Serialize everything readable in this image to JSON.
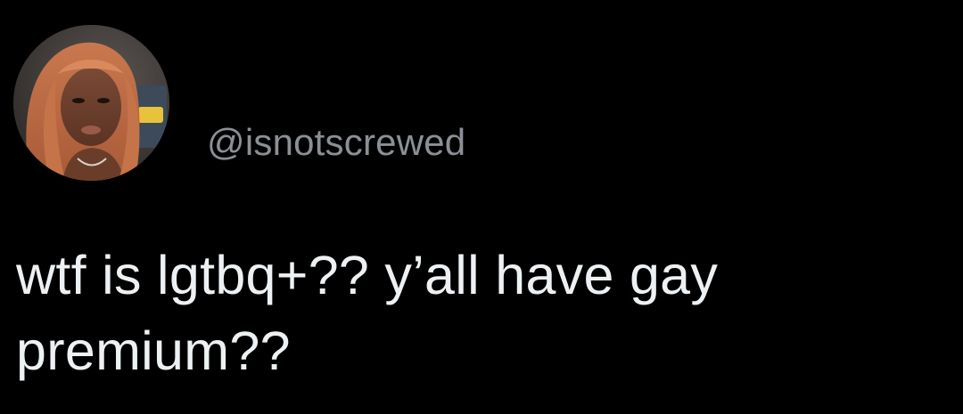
{
  "tweet": {
    "avatar_icon": "profile-photo-avatar",
    "handle": "@isnotscrewed",
    "text_lines": [
      "wtf is lgtbq+?? y’all have gay",
      "premium??"
    ]
  },
  "colors": {
    "background": "#000000",
    "handle": "#8b9096",
    "text": "#eef1f3"
  }
}
